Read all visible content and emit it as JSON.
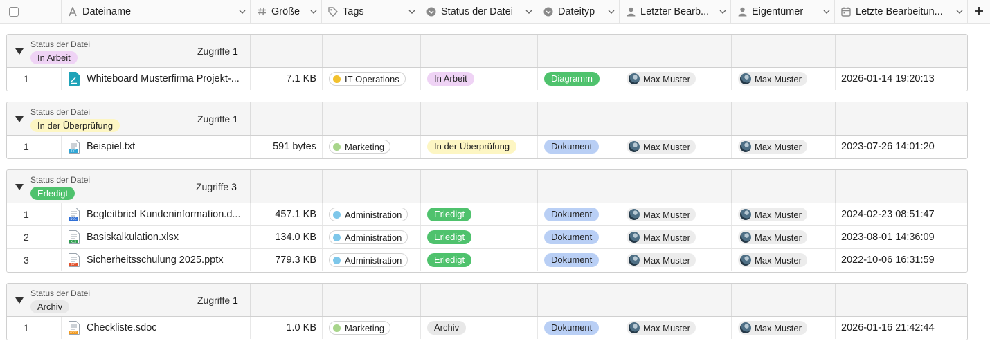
{
  "header": {
    "columns": [
      {
        "label": "Dateiname",
        "icon": "text-type-icon"
      },
      {
        "label": "Größe",
        "icon": "hash-icon"
      },
      {
        "label": "Tags",
        "icon": "tag-icon"
      },
      {
        "label": "Status der Datei",
        "icon": "single-select-icon"
      },
      {
        "label": "Dateityp",
        "icon": "single-select-icon"
      },
      {
        "label": "Letzter Bearb...",
        "icon": "person-icon"
      },
      {
        "label": "Eigentümer",
        "icon": "person-icon"
      },
      {
        "label": "Letzte Bearbeitun...",
        "icon": "calendar-icon"
      }
    ]
  },
  "colors": {
    "tag_it": "#f2c12e",
    "tag_marketing": "#a8d58b",
    "tag_admin": "#7ec7ea",
    "status_in_arbeit": "#efd3f5",
    "status_review": "#fdf6c3",
    "status_done": "#4fc26d",
    "status_archiv": "#e8e8e8",
    "type_diagramm": "#4fc26d",
    "type_dokument": "#b9cff5"
  },
  "groups": [
    {
      "group_label": "Status der Datei",
      "value": "In Arbeit",
      "count_label": "Zugriffe",
      "count": "1",
      "rows": [
        {
          "num": "1",
          "file": "Whiteboard Musterfirma Projekt-...",
          "file_icon": "whiteboard-file-icon",
          "size": "7.1 KB",
          "tag": "IT-Operations",
          "status": "In Arbeit",
          "type": "Diagramm",
          "editor": "Max Muster",
          "owner": "Max Muster",
          "date": "2026-01-14 19:20:13"
        }
      ]
    },
    {
      "group_label": "Status der Datei",
      "value": "In der Überprüfung",
      "count_label": "Zugriffe",
      "count": "1",
      "rows": [
        {
          "num": "1",
          "file": "Beispiel.txt",
          "file_icon": "txt-file-icon",
          "size": "591 bytes",
          "tag": "Marketing",
          "status": "In der Überprüfung",
          "type": "Dokument",
          "editor": "Max Muster",
          "owner": "Max Muster",
          "date": "2023-07-26 14:01:20"
        }
      ]
    },
    {
      "group_label": "Status der Datei",
      "value": "Erledigt",
      "count_label": "Zugriffe",
      "count": "3",
      "rows": [
        {
          "num": "1",
          "file": "Begleitbrief Kundeninformation.d...",
          "file_icon": "doc-file-icon",
          "size": "457.1 KB",
          "tag": "Administration",
          "status": "Erledigt",
          "type": "Dokument",
          "editor": "Max Muster",
          "owner": "Max Muster",
          "date": "2024-02-23 08:51:47"
        },
        {
          "num": "2",
          "file": "Basiskalkulation.xlsx",
          "file_icon": "xls-file-icon",
          "size": "134.0 KB",
          "tag": "Administration",
          "status": "Erledigt",
          "type": "Dokument",
          "editor": "Max Muster",
          "owner": "Max Muster",
          "date": "2023-08-01 14:36:09"
        },
        {
          "num": "3",
          "file": "Sicherheitsschulung 2025.pptx",
          "file_icon": "ppt-file-icon",
          "size": "779.3 KB",
          "tag": "Administration",
          "status": "Erledigt",
          "type": "Dokument",
          "editor": "Max Muster",
          "owner": "Max Muster",
          "date": "2022-10-06 16:31:59"
        }
      ]
    },
    {
      "group_label": "Status der Datei",
      "value": "Archiv",
      "count_label": "Zugriffe",
      "count": "1",
      "rows": [
        {
          "num": "1",
          "file": "Checkliste.sdoc",
          "file_icon": "sdoc-file-icon",
          "size": "1.0 KB",
          "tag": "Marketing",
          "status": "Archiv",
          "type": "Dokument",
          "editor": "Max Muster",
          "owner": "Max Muster",
          "date": "2026-01-16 21:42:44"
        }
      ]
    }
  ]
}
